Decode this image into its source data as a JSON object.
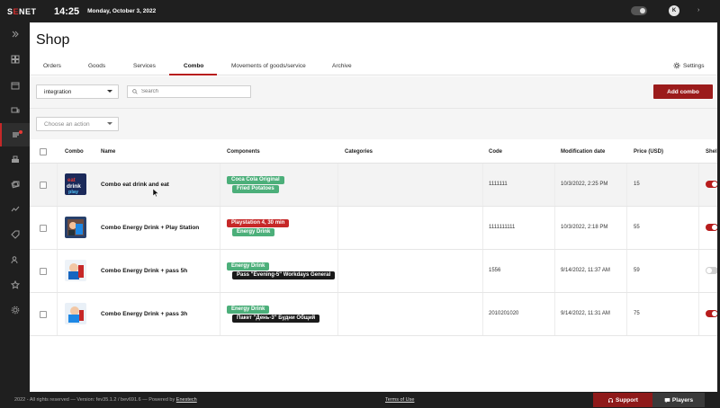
{
  "app": {
    "brand_prefix": "S",
    "brand_accent": "E",
    "brand_suffix": "NET",
    "time": "14:25",
    "date": "Monday, October 3, 2022",
    "user_initial": "K"
  },
  "page": {
    "title": "Shop"
  },
  "tabs": [
    {
      "label": "Orders"
    },
    {
      "label": "Goods"
    },
    {
      "label": "Services"
    },
    {
      "label": "Combo"
    },
    {
      "label": "Movements of goods/service"
    },
    {
      "label": "Archive"
    }
  ],
  "settings_label": "Settings",
  "toolbar": {
    "filter_value": "integration",
    "search_placeholder": "Search",
    "add_label": "Add combo",
    "action_placeholder": "Choose an action"
  },
  "table": {
    "headers": {
      "combo": "Combo",
      "name": "Name",
      "components": "Components",
      "categories": "Categories",
      "code": "Code",
      "modified": "Modification date",
      "price": "Price (USD)",
      "shell": "Shell"
    },
    "rows": [
      {
        "name": "Combo eat drink and eat",
        "tags": [
          "Coca Cola Original",
          "Fried Potatoes"
        ],
        "code": "1111111",
        "modified": "10/3/2022, 2:25 PM",
        "price": "15",
        "shell": true
      },
      {
        "name": "Combo Energy Drink + Play Station",
        "tags": [
          "Playstation 4, 30 min",
          "Energy Drink"
        ],
        "code": "1111111111",
        "modified": "10/3/2022, 2:18 PM",
        "price": "55",
        "shell": true
      },
      {
        "name": "Combo Energy Drink + pass 5h",
        "tags": [
          "Energy Drink",
          "Pass \"Evening-5\" Workdays General"
        ],
        "code": "1556",
        "modified": "9/14/2022, 11:37 AM",
        "price": "59",
        "shell": false
      },
      {
        "name": "Combo Energy Drink + pass 3h",
        "tags": [
          "Energy Drink",
          "Пакет \"День-3\" Будни Общий"
        ],
        "code": "2010201020",
        "modified": "9/14/2022, 11:31 AM",
        "price": "75",
        "shell": true
      }
    ]
  },
  "footer": {
    "copyright": "2022 - All rights reserved — Version: fev35.1.2 / bev691.6 — Powered by",
    "powered_link": "Enestech",
    "terms": "Terms of Use",
    "support": "Support",
    "players": "Players"
  },
  "colors": {
    "accent": "#b71c1c",
    "tag_green": "#4caf7a",
    "tag_red": "#c62828",
    "tag_black": "#1a1a1a",
    "sidebar_bg": "#1f1f1f"
  }
}
